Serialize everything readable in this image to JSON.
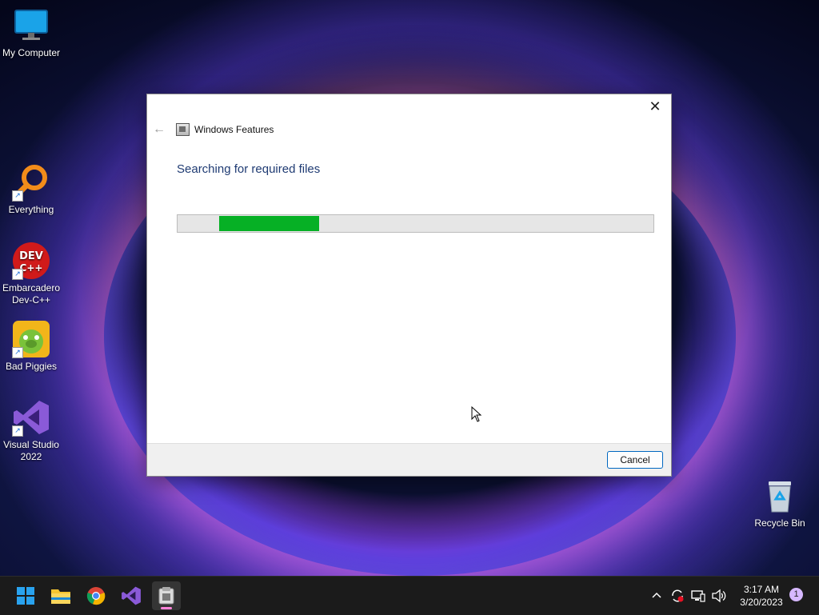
{
  "desktop": {
    "icons": [
      {
        "label": "My Computer"
      },
      {
        "label": "Everything"
      },
      {
        "label": "Embarcadero Dev-C++"
      },
      {
        "label": "Bad Piggies"
      },
      {
        "label": "Visual Studio 2022"
      },
      {
        "label": "Recycle Bin"
      }
    ]
  },
  "dialog": {
    "title": "Windows Features",
    "heading": "Searching for required files",
    "progress_visible_fill": 0.21,
    "cancel_label": "Cancel",
    "close_glyph": "✕",
    "back_glyph": "←"
  },
  "taskbar": {
    "apps": [
      "start-icon",
      "file-explorer-icon",
      "chrome-icon",
      "visual-studio-icon",
      "windows-features-icon"
    ],
    "clock": {
      "time": "3:17 AM",
      "date": "3/20/2023"
    },
    "notification_count": "1"
  },
  "colors": {
    "progress": "#06b025",
    "accent": "#0067c0",
    "heading": "#1f3b73"
  }
}
